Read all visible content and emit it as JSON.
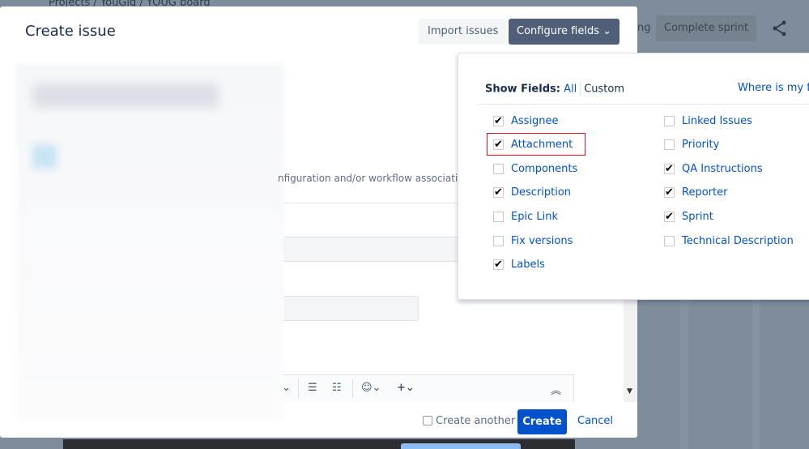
{
  "background": {
    "breadcrumb": "Projects  /  YouGig  /  YOUG board",
    "partial_text": "ng",
    "complete_sprint": "Complete sprint",
    "share_icon": "share-icon"
  },
  "modal": {
    "title": "Create issue",
    "import_label": "Import issues",
    "configure_label": "Configure fields",
    "hint_text": "nfiguration and/or workflow associations",
    "create_another_label": "Create another",
    "create_another_checked": false,
    "create_label": "Create",
    "cancel_label": "Cancel"
  },
  "config_panel": {
    "show_fields_label": "Show Fields:",
    "all_label": "All",
    "custom_label": "Custom",
    "where_label": "Where is my fi",
    "highlight_color": "#e8101b",
    "left_fields": [
      {
        "label": "Assignee",
        "checked": true
      },
      {
        "label": "Attachment",
        "checked": true
      },
      {
        "label": "Components",
        "checked": false
      },
      {
        "label": "Description",
        "checked": true
      },
      {
        "label": "Epic Link",
        "checked": false
      },
      {
        "label": "Fix versions",
        "checked": false
      },
      {
        "label": "Labels",
        "checked": true
      }
    ],
    "right_fields": [
      {
        "label": "Linked Issues",
        "checked": false
      },
      {
        "label": "Priority",
        "checked": false
      },
      {
        "label": "QA Instructions",
        "checked": true
      },
      {
        "label": "Reporter",
        "checked": true
      },
      {
        "label": "Sprint",
        "checked": true
      },
      {
        "label": "Technical Description",
        "checked": false
      }
    ]
  },
  "colors": {
    "primary": "#0052cc",
    "configure_button": "#4e5f77"
  }
}
